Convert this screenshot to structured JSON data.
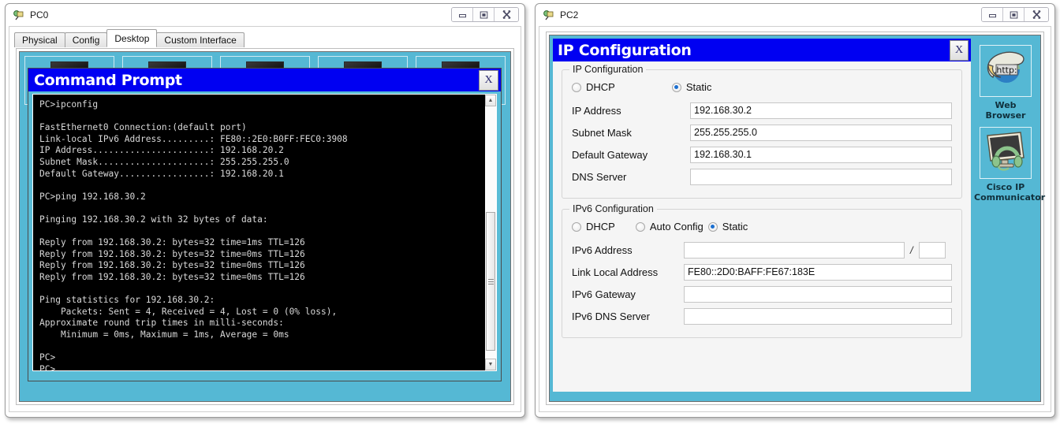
{
  "windows": {
    "left": {
      "title": "PC0",
      "icon": "packet-tracer-device-icon",
      "controls": {
        "minimize": "–",
        "maximize": "❐",
        "close": "✕"
      },
      "tabs": [
        {
          "label": "Physical",
          "active": false
        },
        {
          "label": "Config",
          "active": false
        },
        {
          "label": "Desktop",
          "active": true
        },
        {
          "label": "Custom Interface",
          "active": false
        }
      ],
      "command_prompt": {
        "title": "Command Prompt",
        "close_label": "X",
        "console_text": "PC>ipconfig\n\nFastEthernet0 Connection:(default port)\nLink-local IPv6 Address.........: FE80::2E0:B0FF:FEC0:3908\nIP Address......................: 192.168.20.2\nSubnet Mask.....................: 255.255.255.0\nDefault Gateway.................: 192.168.20.1\n\nPC>ping 192.168.30.2\n\nPinging 192.168.30.2 with 32 bytes of data:\n\nReply from 192.168.30.2: bytes=32 time=1ms TTL=126\nReply from 192.168.30.2: bytes=32 time=0ms TTL=126\nReply from 192.168.30.2: bytes=32 time=0ms TTL=126\nReply from 192.168.30.2: bytes=32 time=0ms TTL=126\n\nPing statistics for 192.168.30.2:\n    Packets: Sent = 4, Received = 4, Lost = 0 (0% loss),\nApproximate round trip times in milli-seconds:\n    Minimum = 0ms, Maximum = 1ms, Average = 0ms\n\nPC>\nPC>\nPC>\nPC>",
        "scroll_up": "▲",
        "scroll_down": "▼"
      }
    },
    "right": {
      "title": "PC2",
      "icon": "packet-tracer-device-icon",
      "controls": {
        "minimize": "–",
        "maximize": "❐",
        "close": "✕"
      },
      "ip_configuration": {
        "window_title": "IP Configuration",
        "close_label": "X",
        "ipv4": {
          "legend": "IP Configuration",
          "mode_options": [
            {
              "label": "DHCP",
              "selected": false
            },
            {
              "label": "Static",
              "selected": true
            }
          ],
          "fields": [
            {
              "label": "IP Address",
              "value": "192.168.30.2"
            },
            {
              "label": "Subnet Mask",
              "value": "255.255.255.0"
            },
            {
              "label": "Default Gateway",
              "value": "192.168.30.1"
            },
            {
              "label": "DNS Server",
              "value": ""
            }
          ]
        },
        "ipv6": {
          "legend": "IPv6 Configuration",
          "mode_options": [
            {
              "label": "DHCP",
              "selected": false
            },
            {
              "label": "Auto Config",
              "selected": false
            },
            {
              "label": "Static",
              "selected": true
            }
          ],
          "address_label": "IPv6 Address",
          "address_value": "",
          "prefix_separator": "/",
          "prefix_value": "",
          "fields": [
            {
              "label": "Link Local Address",
              "value": "FE80::2D0:BAFF:FE67:183E"
            },
            {
              "label": "IPv6 Gateway",
              "value": ""
            },
            {
              "label": "IPv6 DNS Server",
              "value": ""
            }
          ]
        }
      },
      "app_dock": [
        {
          "icon": "web-browser-icon",
          "caption": "Web Browser"
        },
        {
          "icon": "cisco-ip-communicator-icon",
          "caption": "Cisco IP\nCommunicator"
        }
      ]
    }
  },
  "colors": {
    "titlebar_blue": "#0000f2",
    "desktop_teal": "#55b8d4",
    "radio_selected": "#1b6fd0",
    "console_bg": "#000000",
    "console_fg": "#d9d9d9"
  }
}
